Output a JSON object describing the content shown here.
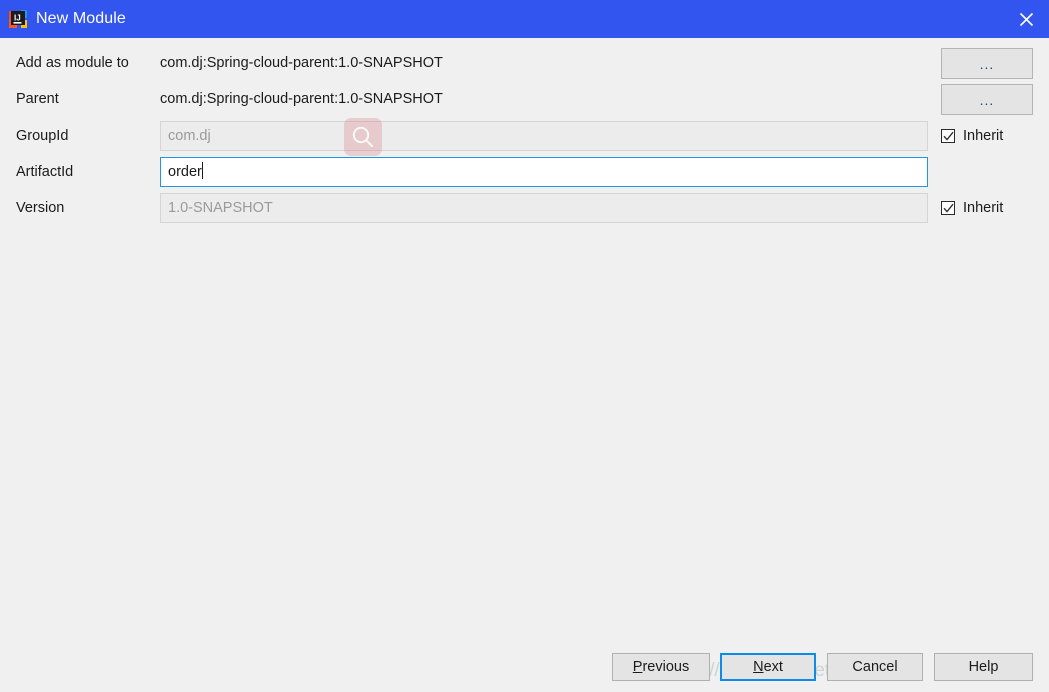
{
  "window": {
    "title": "New Module",
    "app_icon": "intellij-idea-icon",
    "close_icon": "close-icon",
    "titlebar_color": "#3355ef",
    "body_color": "#f0f0f0"
  },
  "form": {
    "rows": [
      {
        "label": "Add as module to",
        "value": "com.dj:Spring-cloud-parent:1.0-SNAPSHOT",
        "type": "static"
      },
      {
        "label": "Parent",
        "value": "com.dj:Spring-cloud-parent:1.0-SNAPSHOT",
        "type": "static"
      },
      {
        "label": "GroupId",
        "value": "com.dj",
        "type": "input",
        "enabled": false
      },
      {
        "label": "ArtifactId",
        "value": "order",
        "type": "input",
        "enabled": true,
        "focused": true
      },
      {
        "label": "Version",
        "value": "1.0-SNAPSHOT",
        "type": "input",
        "enabled": false
      }
    ],
    "browse_buttons": [
      {
        "label": "...",
        "name": "add-as-module-to-browse-button"
      },
      {
        "label": "...",
        "name": "parent-browse-button"
      }
    ],
    "inherit_checkboxes": [
      {
        "label": "Inherit",
        "checked": true,
        "name": "groupid-inherit-checkbox"
      },
      {
        "label": "Inherit",
        "checked": true,
        "name": "version-inherit-checkbox"
      }
    ]
  },
  "overlay": {
    "cursor_icon": "search-icon",
    "highlight_color": "#d67078"
  },
  "footer": {
    "buttons": [
      {
        "label": "Previous",
        "mnemonic": "P",
        "name": "previous-button",
        "focused": false
      },
      {
        "label": "Next",
        "mnemonic": "N",
        "name": "next-button",
        "focused": true
      },
      {
        "label": "Cancel",
        "mnemonic": "",
        "name": "cancel-button",
        "focused": false
      },
      {
        "label": "Help",
        "mnemonic": "",
        "name": "help-button",
        "focused": false
      }
    ],
    "watermark": "https://blog.csdn.net/jokerdj233"
  }
}
